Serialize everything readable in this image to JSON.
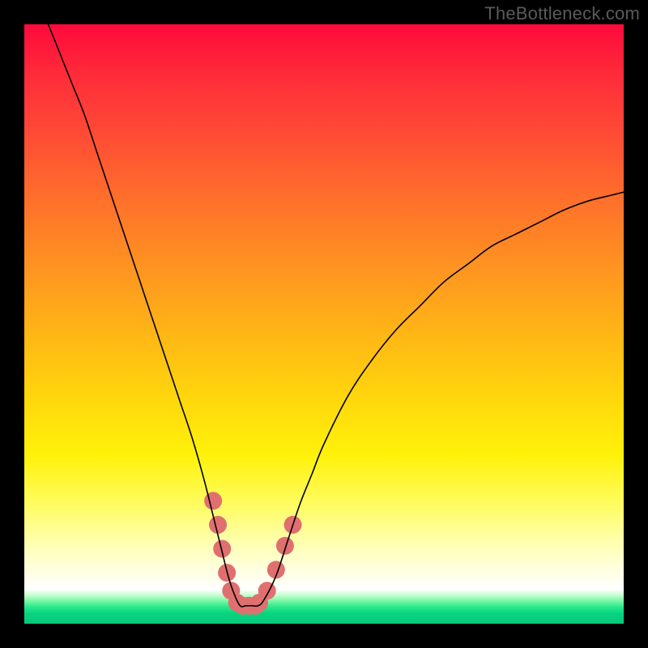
{
  "watermark": {
    "text": "TheBottleneck.com"
  },
  "chart_data": {
    "type": "line",
    "title": "",
    "xlabel": "",
    "ylabel": "",
    "xlim": [
      0,
      100
    ],
    "ylim": [
      0,
      100
    ],
    "series": [
      {
        "name": "bottleneck-curve",
        "x": [
          4,
          6,
          8,
          10,
          12,
          14,
          16,
          18,
          20,
          22,
          24,
          26,
          28,
          30,
          32,
          33,
          34,
          35,
          36,
          37,
          38,
          39,
          40,
          42,
          44,
          46,
          48,
          50,
          54,
          58,
          62,
          66,
          70,
          74,
          78,
          82,
          86,
          90,
          94,
          98,
          100
        ],
        "y": [
          100,
          95,
          90,
          85,
          79,
          73,
          67,
          61,
          55,
          49,
          43,
          37,
          31,
          24,
          16,
          12,
          8,
          5,
          3,
          3,
          3,
          3,
          4,
          8,
          14,
          20,
          25,
          30,
          38,
          44,
          49,
          53,
          57,
          60,
          63,
          65,
          67,
          69,
          70.5,
          71.5,
          72
        ]
      }
    ],
    "highlights": [
      {
        "x": 31.5,
        "y": 20.5
      },
      {
        "x": 32.3,
        "y": 16.5
      },
      {
        "x": 33.0,
        "y": 12.5
      },
      {
        "x": 33.8,
        "y": 8.5
      },
      {
        "x": 34.5,
        "y": 5.5
      },
      {
        "x": 35.5,
        "y": 3.5
      },
      {
        "x": 36.5,
        "y": 3.0
      },
      {
        "x": 37.5,
        "y": 3.0
      },
      {
        "x": 38.5,
        "y": 3.0
      },
      {
        "x": 39.2,
        "y": 3.5
      },
      {
        "x": 40.5,
        "y": 5.5
      },
      {
        "x": 42.0,
        "y": 9.0
      },
      {
        "x": 43.5,
        "y": 13.0
      },
      {
        "x": 44.8,
        "y": 16.5
      }
    ],
    "gradient_stops": [
      {
        "pos": 0.0,
        "color": "#ff0a3c"
      },
      {
        "pos": 0.3,
        "color": "#ff722a"
      },
      {
        "pos": 0.63,
        "color": "#ffd80c"
      },
      {
        "pos": 0.94,
        "color": "#ffffff"
      },
      {
        "pos": 0.97,
        "color": "#29e98a"
      },
      {
        "pos": 1.0,
        "color": "#05c97b"
      }
    ]
  }
}
